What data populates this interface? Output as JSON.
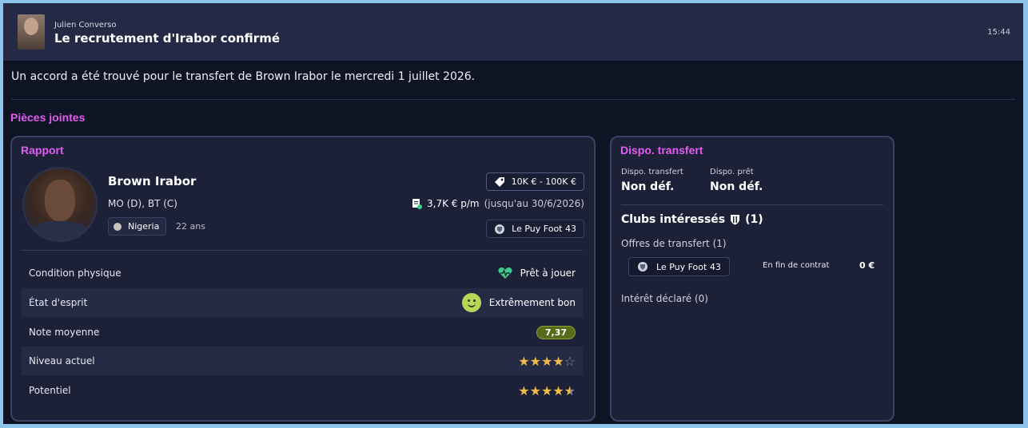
{
  "header": {
    "sender": "Julien Converso",
    "subject": "Le recrutement d'Irabor confirmé",
    "time": "15:44"
  },
  "message": "Un accord a été trouvé pour le transfert de Brown Irabor le mercredi 1 juillet 2026.",
  "attachments_title": "Pièces jointes",
  "report": {
    "title": "Rapport",
    "player_name": "Brown Irabor",
    "positions": "MO (D), BT (C)",
    "nationality": "Nigeria",
    "age": "22 ans",
    "value_range": "10K € - 100K €",
    "wage": "3,7K € p/m",
    "contract_until": "(jusqu'au 30/6/2026)",
    "club": "Le Puy Foot 43",
    "attributes": [
      {
        "label": "Condition physique",
        "value": "Prêt à jouer",
        "icon": "heart-pulse-icon"
      },
      {
        "label": "État d'esprit",
        "value": "Extrêmement bon",
        "icon": "smiley-icon"
      },
      {
        "label": "Note moyenne",
        "value": "7,37"
      },
      {
        "label": "Niveau actuel",
        "stars": 4,
        "max_stars": 5
      },
      {
        "label": "Potentiel",
        "stars": 4.5,
        "max_stars": 5
      }
    ]
  },
  "dispo": {
    "title": "Dispo. transfert",
    "transfer_label": "Dispo. transfert",
    "transfer_value": "Non déf.",
    "loan_label": "Dispo. prêt",
    "loan_value": "Non déf.",
    "clubs_title": "Clubs intéressés",
    "clubs_count": "(1)",
    "offers_label": "Offres de transfert",
    "offers_count": "(1)",
    "offer": {
      "club": "Le Puy Foot 43",
      "status": "En fin de contrat",
      "amount": "0 €"
    },
    "interest_label": "Intérêt déclaré",
    "interest_count": "(0)"
  },
  "colors": {
    "accent_title": "#e35cf0",
    "star": "#f1bb4a",
    "rating_bg": "#586b1b",
    "fitness_green": "#3ecf8e"
  }
}
